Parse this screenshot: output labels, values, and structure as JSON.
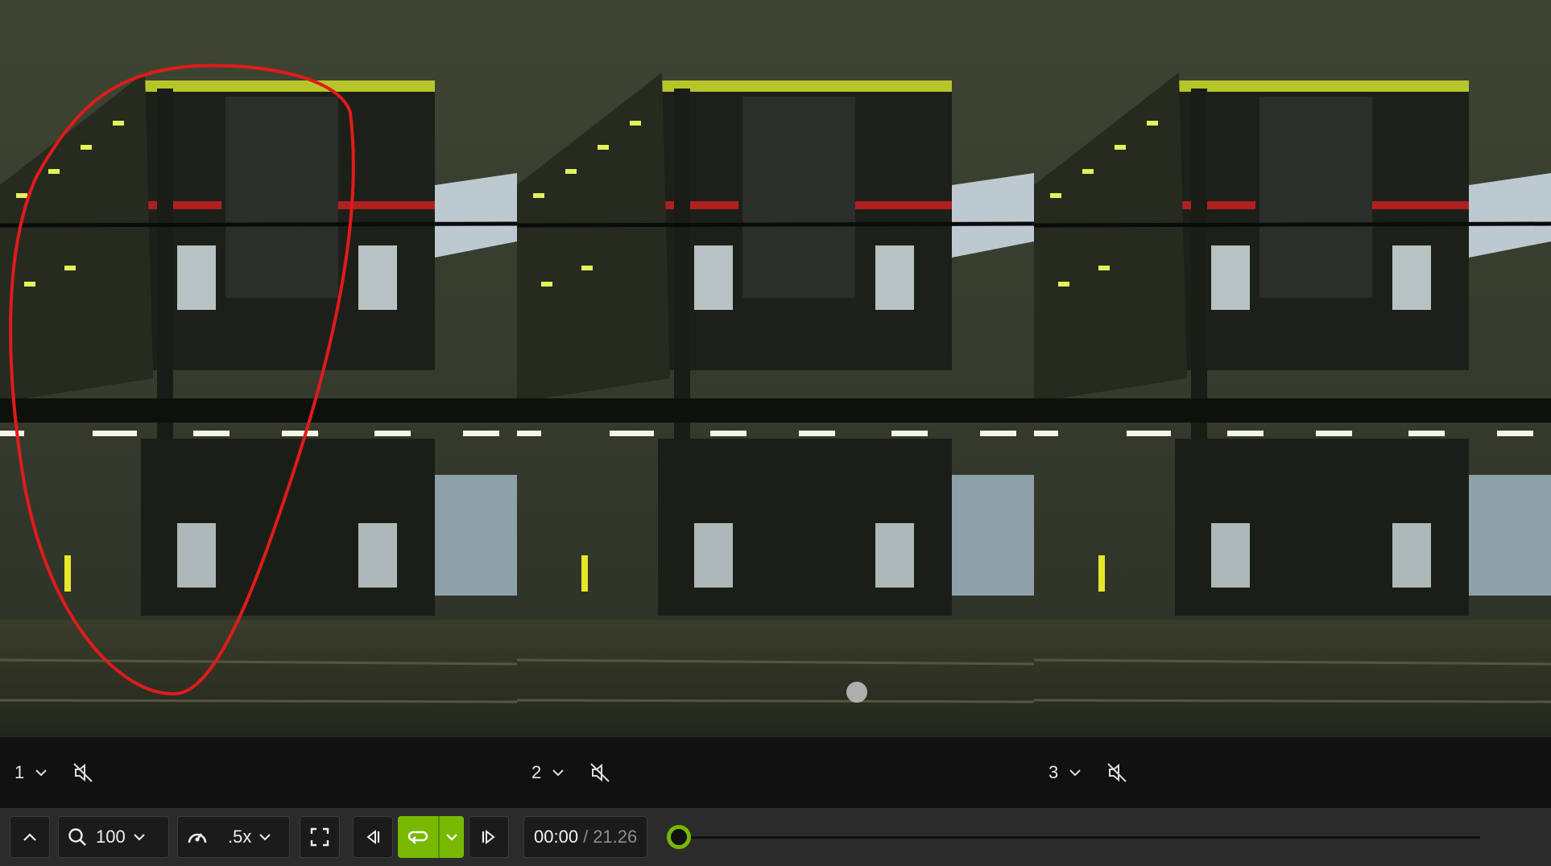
{
  "panels": [
    {
      "number": "1",
      "audio_icon": "muted-speaker-icon",
      "annotation": "red-ellipse"
    },
    {
      "number": "2",
      "audio_icon": "muted-speaker-icon"
    },
    {
      "number": "3",
      "audio_icon": "muted-speaker-icon"
    }
  ],
  "controls": {
    "zoom_value": "100",
    "speed_value": ".5x",
    "current_time": "00:00",
    "time_separator": "/",
    "duration": "21.26",
    "playback_position": 0,
    "loop_enabled": true
  },
  "colors": {
    "accent": "#76b900",
    "annotation": "#e01b1b",
    "bar_bg": "#2b2b2b",
    "panel_label_bg": "#111111"
  }
}
